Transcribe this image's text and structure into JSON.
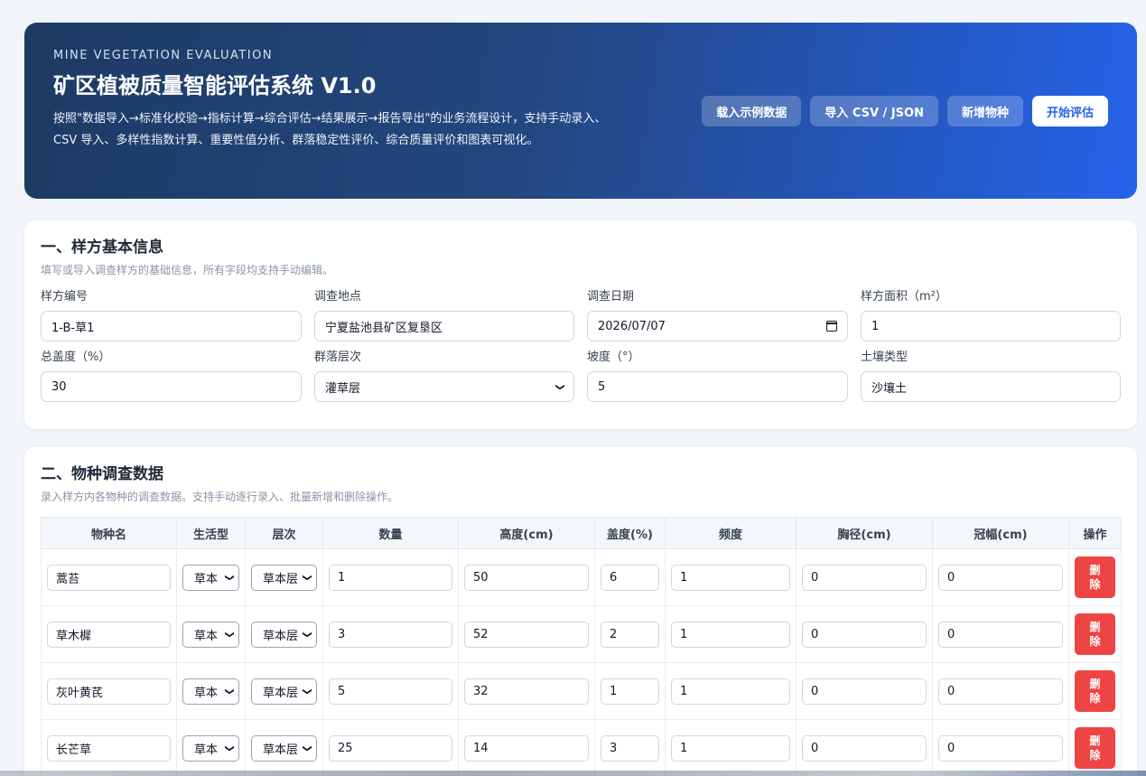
{
  "hero": {
    "eyebrow": "MINE VEGETATION EVALUATION",
    "title": "矿区植被质量智能评估系统 V1.0",
    "description": "按照\"数据导入→标准化校验→指标计算→综合评估→结果展示→报告导出\"的业务流程设计，支持手动录入、CSV 导入、多样性指数计算、重要性值分析、群落稳定性评价、综合质量评价和图表可视化。",
    "buttons": {
      "load_sample": "载入示例数据",
      "import": "导入 CSV / JSON",
      "add_species": "新增物种",
      "start": "开始评估"
    }
  },
  "section1": {
    "title": "一、样方基本信息",
    "subtitle": "填写或导入调查样方的基础信息，所有字段均支持手动编辑。",
    "fields": {
      "plot_id": {
        "label": "样方编号",
        "value": "1-B-草1"
      },
      "location": {
        "label": "调查地点",
        "value": "宁夏盐池县矿区复垦区"
      },
      "date": {
        "label": "调查日期",
        "value": "2026/07/07"
      },
      "area": {
        "label": "样方面积（m²）",
        "value": "1"
      },
      "coverage": {
        "label": "总盖度（%）",
        "value": "30"
      },
      "layer": {
        "label": "群落层次",
        "value": "灌草层"
      },
      "slope": {
        "label": "坡度（°）",
        "value": "5"
      },
      "soil": {
        "label": "土壤类型",
        "value": "沙壤土"
      }
    }
  },
  "section2": {
    "title": "二、物种调查数据",
    "subtitle": "录入样方内各物种的调查数据。支持手动逐行录入、批量新增和删除操作。",
    "columns": [
      "物种名",
      "生活型",
      "层次",
      "数量",
      "高度(cm)",
      "盖度(%)",
      "频度",
      "胸径(cm)",
      "冠幅(cm)",
      "操作"
    ],
    "delete_label_top": "删",
    "delete_label_bottom": "除",
    "rows": [
      {
        "name": "蒿苔",
        "life": "草本",
        "layer": "草本层",
        "count": "1",
        "height": "50",
        "cover": "6",
        "freq": "1",
        "dbh": "0",
        "crown": "0"
      },
      {
        "name": "草木樨",
        "life": "草本",
        "layer": "草本层",
        "count": "3",
        "height": "52",
        "cover": "2",
        "freq": "1",
        "dbh": "0",
        "crown": "0"
      },
      {
        "name": "灰叶黄芪",
        "life": "草本",
        "layer": "草本层",
        "count": "5",
        "height": "32",
        "cover": "1",
        "freq": "1",
        "dbh": "0",
        "crown": "0"
      },
      {
        "name": "长芒草",
        "life": "草本",
        "layer": "草本层",
        "count": "25",
        "height": "14",
        "cover": "3",
        "freq": "1",
        "dbh": "0",
        "crown": "0"
      }
    ]
  }
}
